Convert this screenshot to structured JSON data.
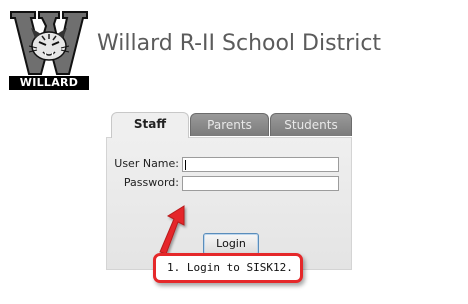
{
  "header": {
    "logo_text": "WILLARD",
    "district_title": "Willard R-II School District"
  },
  "login_tabs": [
    {
      "label": "Staff",
      "active": true
    },
    {
      "label": "Parents",
      "active": false
    },
    {
      "label": "Students",
      "active": false
    }
  ],
  "form": {
    "username_label": "User Name:",
    "username_value": "",
    "password_label": "Password:",
    "password_value": "",
    "login_label": "Login"
  },
  "annotation": {
    "text": "1.  Login to SISK12.",
    "color": "#e5282a"
  },
  "colors": {
    "title_text": "#5b5b5b",
    "tab_inactive": "#8a8a8a",
    "panel_bg": "#efefef",
    "button_border": "#5a8dbb"
  }
}
